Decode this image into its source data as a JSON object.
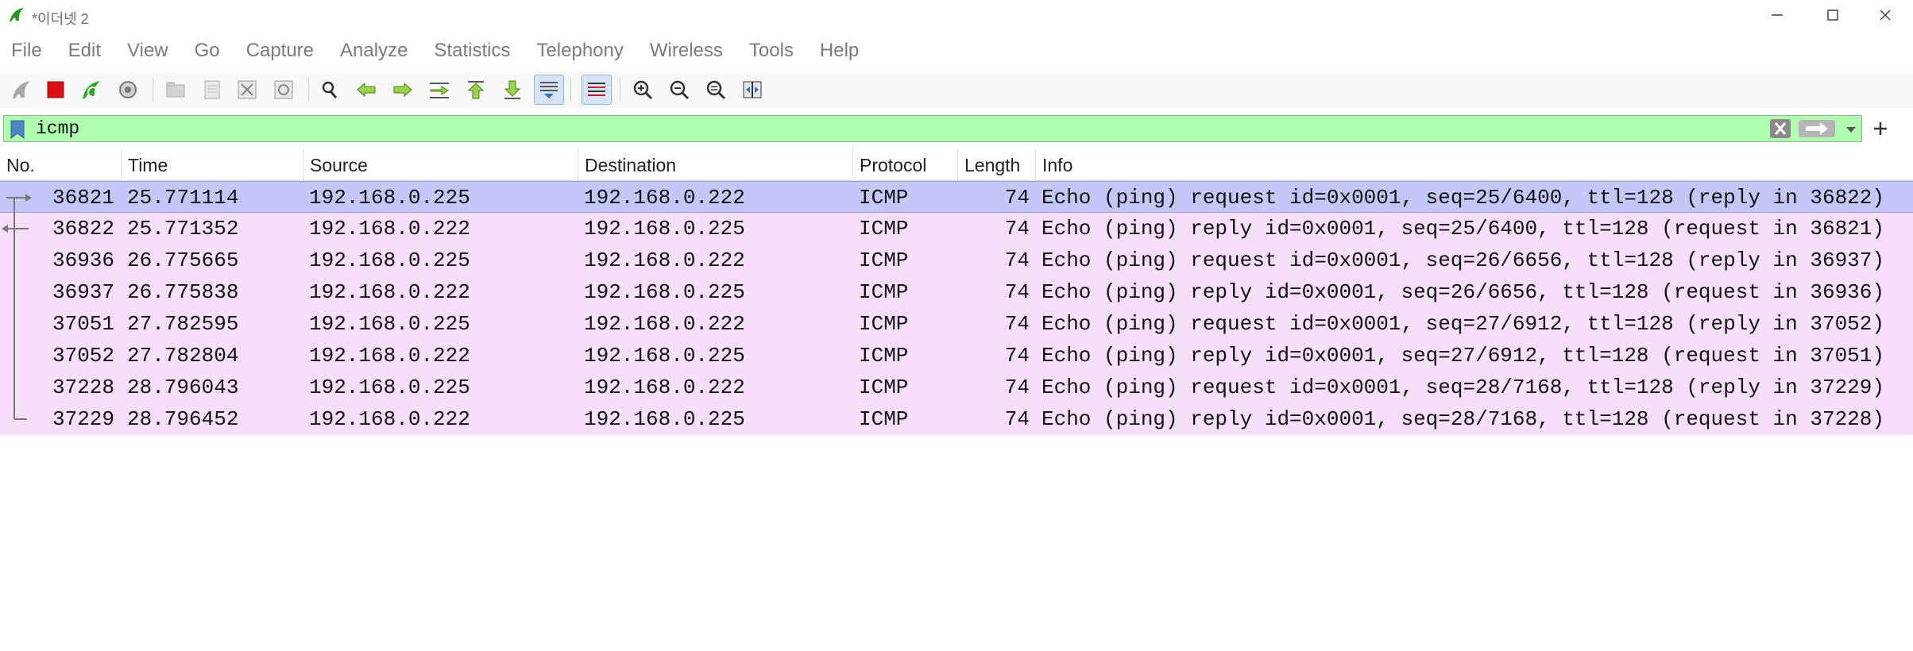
{
  "window": {
    "title": "*이더넷 2"
  },
  "menu": [
    "File",
    "Edit",
    "View",
    "Go",
    "Capture",
    "Analyze",
    "Statistics",
    "Telephony",
    "Wireless",
    "Tools",
    "Help"
  ],
  "toolbar": {
    "icons": [
      "shark-fin-start-icon",
      "stop-capture-icon",
      "restart-capture-icon",
      "capture-options-icon",
      "open-file-icon",
      "save-file-icon",
      "close-file-icon",
      "reload-file-icon",
      "find-packet-icon",
      "go-back-icon",
      "go-forward-icon",
      "go-to-packet-icon",
      "first-packet-icon",
      "last-packet-icon",
      "autoscroll-icon",
      "colorize-icon",
      "zoom-in-icon",
      "zoom-out-icon",
      "zoom-normal-icon",
      "resize-columns-icon"
    ]
  },
  "filter": {
    "value": "icmp",
    "bg_color": "#afffaf"
  },
  "columns": {
    "no": "No.",
    "time": "Time",
    "source": "Source",
    "destination": "Destination",
    "protocol": "Protocol",
    "length": "Length",
    "info": "Info"
  },
  "packets": [
    {
      "no": "36821",
      "time": "25.771114",
      "source": "192.168.0.225",
      "destination": "192.168.0.222",
      "protocol": "ICMP",
      "length": "74",
      "info": "Echo (ping) request  id=0x0001, seq=25/6400, ttl=128 (reply in 36822)",
      "selected": true
    },
    {
      "no": "36822",
      "time": "25.771352",
      "source": "192.168.0.222",
      "destination": "192.168.0.225",
      "protocol": "ICMP",
      "length": "74",
      "info": "Echo (ping) reply    id=0x0001, seq=25/6400, ttl=128 (request in 36821)"
    },
    {
      "no": "36936",
      "time": "26.775665",
      "source": "192.168.0.225",
      "destination": "192.168.0.222",
      "protocol": "ICMP",
      "length": "74",
      "info": "Echo (ping) request  id=0x0001, seq=26/6656, ttl=128 (reply in 36937)"
    },
    {
      "no": "36937",
      "time": "26.775838",
      "source": "192.168.0.222",
      "destination": "192.168.0.225",
      "protocol": "ICMP",
      "length": "74",
      "info": "Echo (ping) reply    id=0x0001, seq=26/6656, ttl=128 (request in 36936)"
    },
    {
      "no": "37051",
      "time": "27.782595",
      "source": "192.168.0.225",
      "destination": "192.168.0.222",
      "protocol": "ICMP",
      "length": "74",
      "info": "Echo (ping) request  id=0x0001, seq=27/6912, ttl=128 (reply in 37052)"
    },
    {
      "no": "37052",
      "time": "27.782804",
      "source": "192.168.0.222",
      "destination": "192.168.0.225",
      "protocol": "ICMP",
      "length": "74",
      "info": "Echo (ping) reply    id=0x0001, seq=27/6912, ttl=128 (request in 37051)"
    },
    {
      "no": "37228",
      "time": "28.796043",
      "source": "192.168.0.225",
      "destination": "192.168.0.222",
      "protocol": "ICMP",
      "length": "74",
      "info": "Echo (ping) request  id=0x0001, seq=28/7168, ttl=128 (reply in 37229)"
    },
    {
      "no": "37229",
      "time": "28.796452",
      "source": "192.168.0.222",
      "destination": "192.168.0.225",
      "protocol": "ICMP",
      "length": "74",
      "info": "Echo (ping) reply    id=0x0001, seq=28/7168, ttl=128 (request in 37228)"
    }
  ],
  "colors": {
    "row_bg": "#f8e0fc",
    "selected_bg": "#c4c8f8"
  }
}
